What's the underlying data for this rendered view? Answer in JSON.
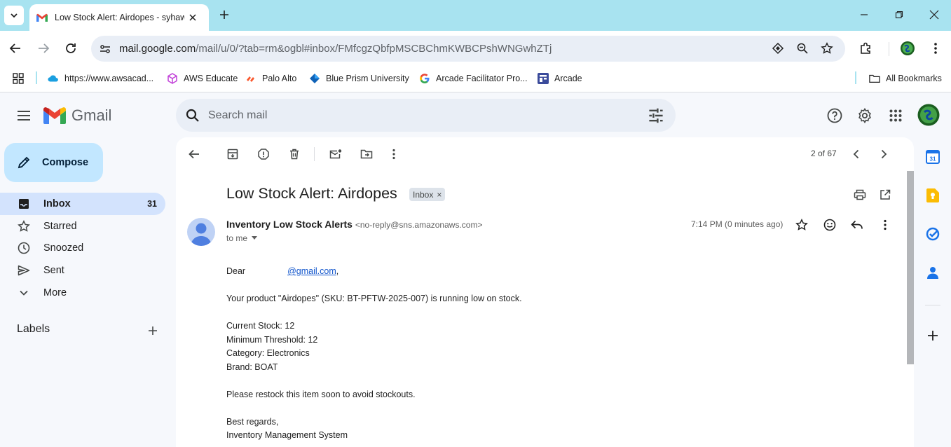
{
  "browser": {
    "tab_title": "Low Stock Alert: Airdopes - syhaw",
    "url_host": "mail.google.com",
    "url_rest": "/mail/u/0/?tab=rm&ogbl#inbox/FMfcgzQbfpMSCBChmKWBCPshWNGwhZTj",
    "bookmarks": [
      {
        "label": "https://www.awsacad..."
      },
      {
        "label": "AWS Educate"
      },
      {
        "label": "Palo Alto"
      },
      {
        "label": "Blue Prism University"
      },
      {
        "label": "Arcade Facilitator Pro..."
      },
      {
        "label": "Arcade"
      }
    ],
    "all_bookmarks": "All Bookmarks"
  },
  "gmail": {
    "logo_text": "Gmail",
    "search_placeholder": "Search mail",
    "compose_label": "Compose",
    "nav": [
      {
        "label": "Inbox",
        "count": "31"
      },
      {
        "label": "Starred"
      },
      {
        "label": "Snoozed"
      },
      {
        "label": "Sent"
      },
      {
        "label": "More"
      }
    ],
    "labels_header": "Labels"
  },
  "message": {
    "pager": "2 of 67",
    "subject": "Low Stock Alert: Airdopes",
    "chip": "Inbox",
    "sender_name": "Inventory Low Stock Alerts",
    "sender_email": "<no-reply@sns.amazonaws.com>",
    "to": "to me",
    "time": "7:14 PM (0 minutes ago)",
    "greeting": "Dear",
    "greeting_email": "@gmail.com",
    "greeting_suffix": ",",
    "line1": "Your product \"Airdopes\" (SKU: BT-PFTW-2025-007) is running low on stock.",
    "current_stock": "Current Stock: 12",
    "min_threshold": "Minimum Threshold: 12",
    "category": "Category: Electronics",
    "brand": "Brand: BOAT",
    "restock": "Please restock this item soon to avoid stockouts.",
    "regards": "Best regards,",
    "signature": "Inventory Management System"
  },
  "colors": {
    "tabstrip": "#a8e3f0",
    "compose": "#c2e7ff",
    "nav_active": "#d3e3fd",
    "link": "#1155cc"
  }
}
